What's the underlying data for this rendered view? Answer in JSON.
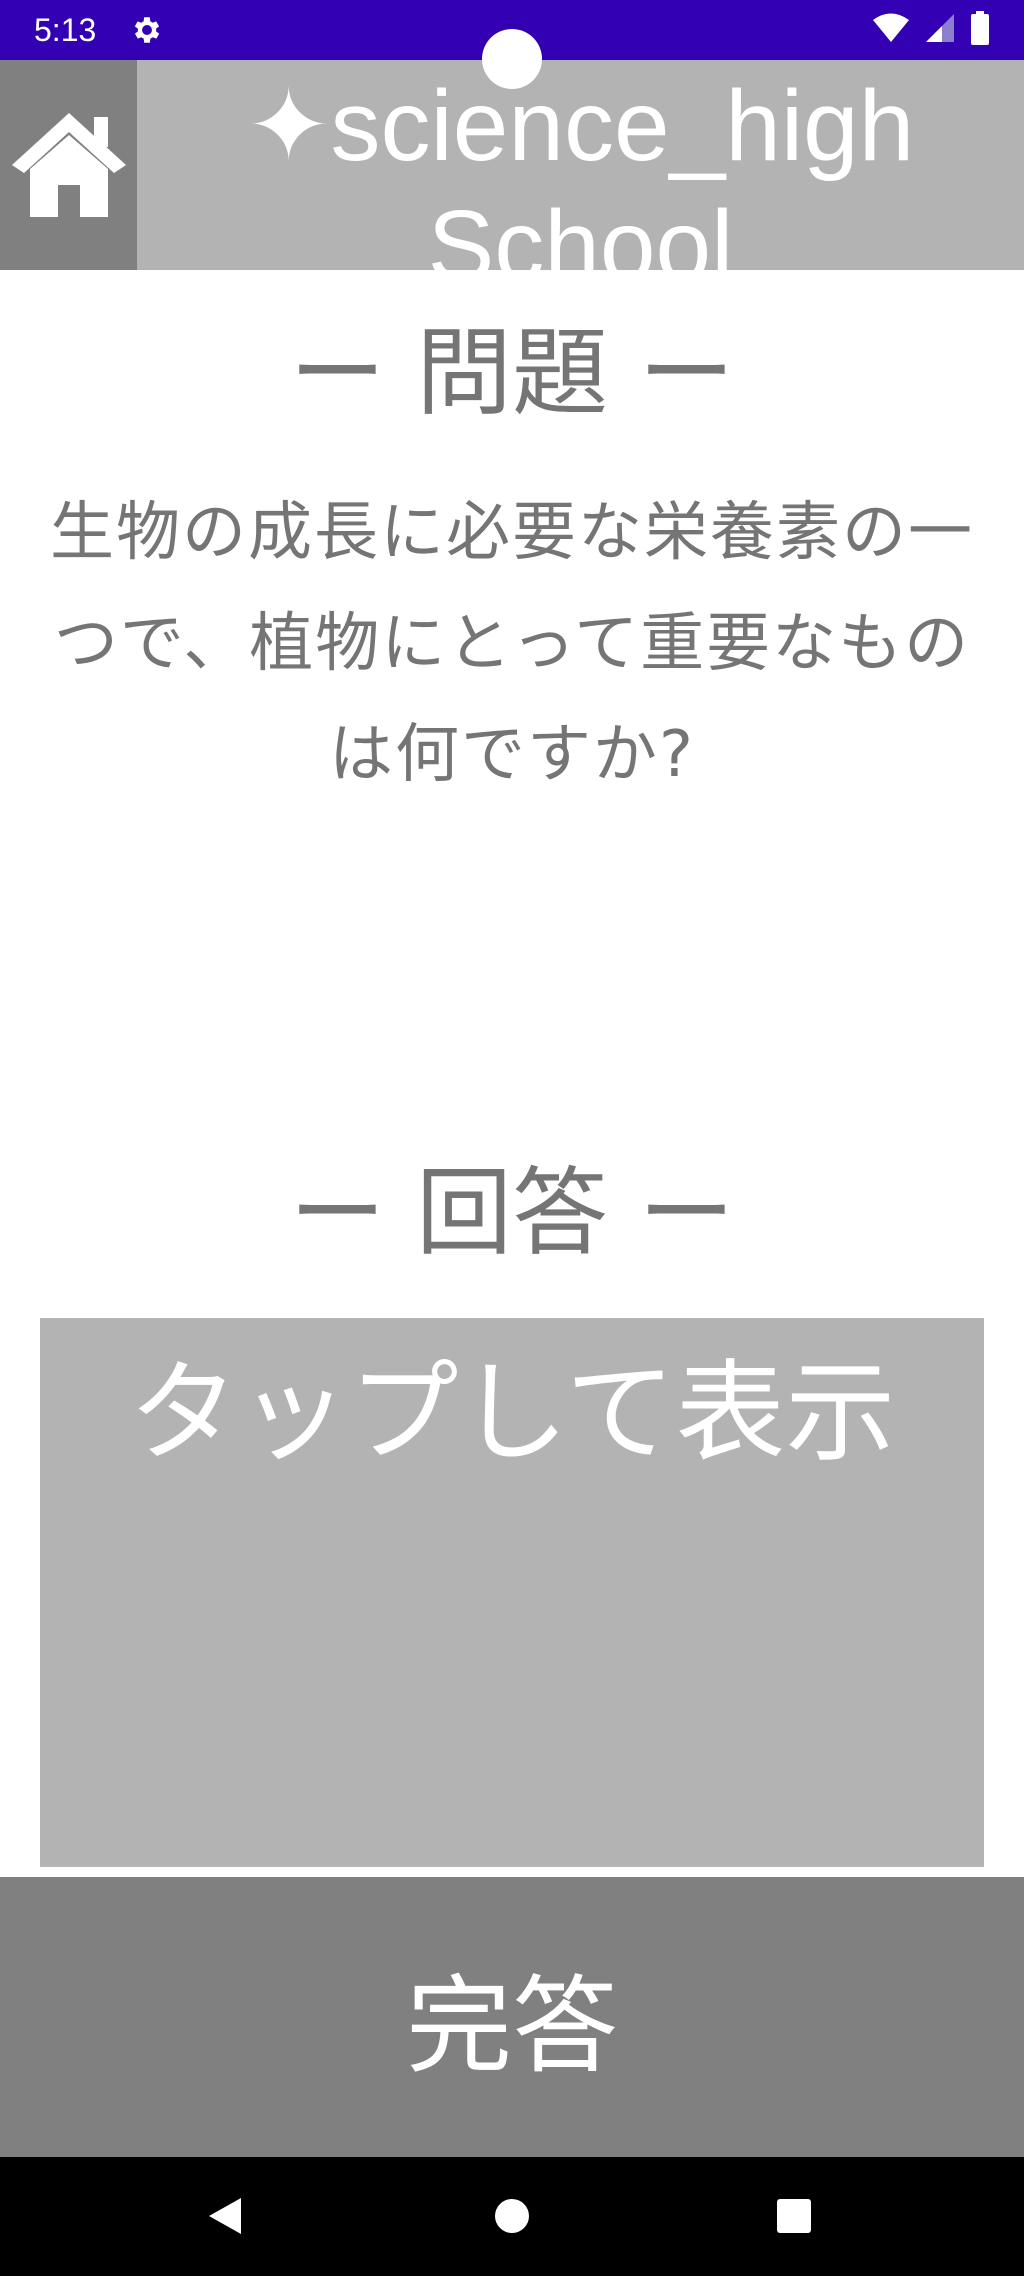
{
  "status_bar": {
    "time": "5:13",
    "icons": [
      "gear-icon",
      "wifi-icon",
      "signal-icon",
      "battery-icon"
    ],
    "background_color": "#3300b3"
  },
  "header": {
    "home_icon": "home-icon",
    "title_line1": "✦science_high",
    "title_line2": "School"
  },
  "question": {
    "heading": "ー 問題 ー",
    "text": "生物の成長に必要な栄養素の一つで、植物にとって重要なものは何ですか?"
  },
  "answer": {
    "heading": "ー 回答 ー",
    "placeholder": "タップして表示"
  },
  "complete_button": {
    "label": "完答"
  },
  "navigation": {
    "icons": [
      "back-icon",
      "home-circle-icon",
      "recents-icon"
    ]
  },
  "colors": {
    "header_bg": "#b3b3b3",
    "home_bg": "#808080",
    "text_gray": "#757575",
    "button_bg": "#808080"
  }
}
